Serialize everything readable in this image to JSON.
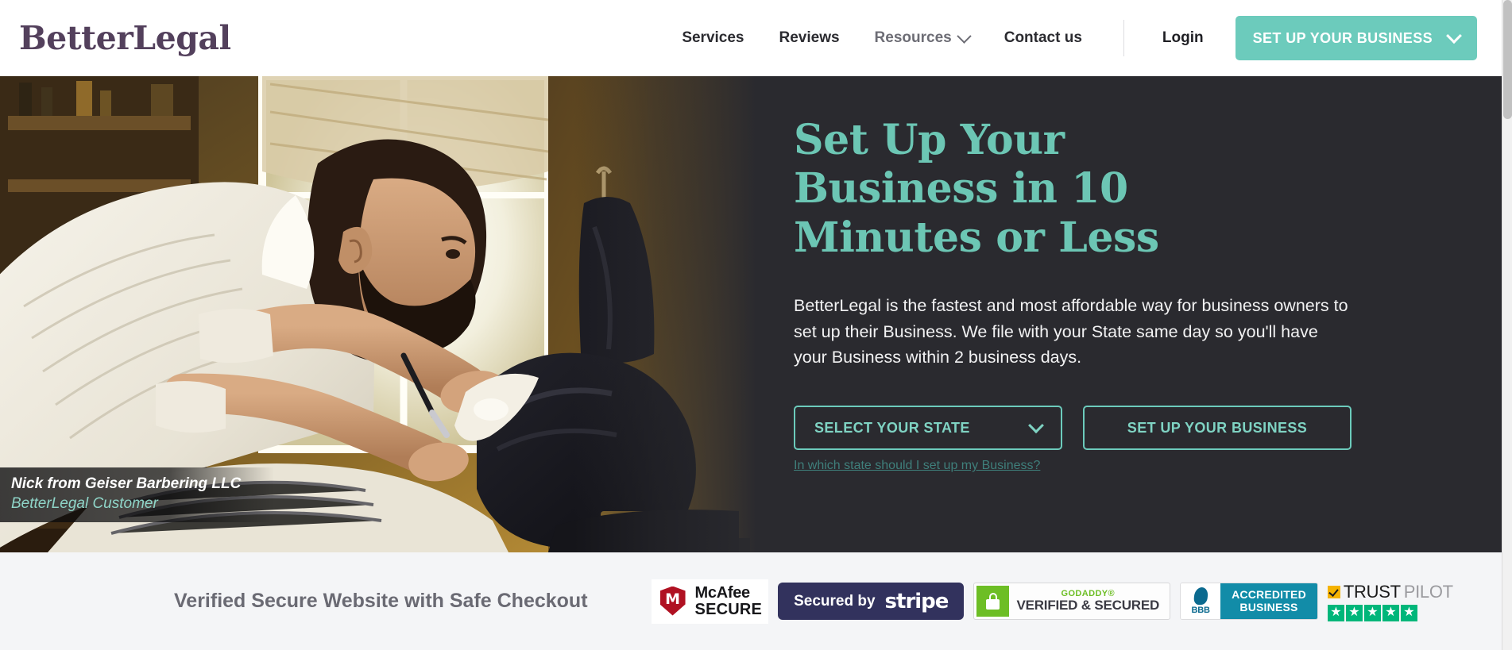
{
  "header": {
    "logo": "BetterLegal",
    "nav": [
      {
        "label": "Services",
        "icon": null
      },
      {
        "label": "Reviews",
        "icon": null
      },
      {
        "label": "Resources",
        "icon": "chevron-down-icon"
      },
      {
        "label": "Contact us",
        "icon": null
      }
    ],
    "login_label": "Login",
    "cta_label": "SET UP YOUR BUSINESS",
    "cta_icon": "chevron-down-icon",
    "cta_color": "#6ccbbc"
  },
  "hero": {
    "heading": "Set Up Your Business in 10 Minutes or Less",
    "paragraph": "BetterLegal is the fastest and most affordable way for business owners to set up their Business. We file with your State same day so you'll have your Business within 2 business days.",
    "select_state_label": "SELECT YOUR STATE",
    "select_state_icon": "chevron-down-icon",
    "setup_button_label": "SET UP YOUR BUSINESS",
    "help_link": "In which state should I set up my Business?",
    "background_color": "#2a2a2f",
    "accent_color": "#6cc6b4",
    "photo": {
      "alt": "Barber shaving a seated client with a straight razor in a barbershop",
      "caption_name": "Nick from Geiser Barbering LLC",
      "caption_role": "BetterLegal Customer"
    }
  },
  "trustbar": {
    "title": "Verified Secure Website with Safe Checkout",
    "background_color": "#f4f5f7",
    "badges": [
      {
        "name": "mcafee-secure-badge",
        "line1": "McAfee",
        "line2": "SECURE",
        "mark": "M",
        "color": "#b01122"
      },
      {
        "name": "stripe-badge",
        "prefix": "Secured by",
        "brand": "stripe",
        "color": "#32325d"
      },
      {
        "name": "godaddy-badge",
        "line1": "GODADDY®",
        "line2": "VERIFIED & SECURED",
        "icon": "lock-icon",
        "color": "#6dbe25"
      },
      {
        "name": "bbb-accredited-badge",
        "mark": "BBB",
        "line1": "ACCREDITED",
        "line2": "BUSINESS",
        "color": "#128ca8"
      },
      {
        "name": "trustpilot-badge",
        "word1": "TRUST",
        "word2": "PILOT",
        "stars": "★★★★★",
        "star_count": 5,
        "color": "#00b67a"
      }
    ]
  }
}
